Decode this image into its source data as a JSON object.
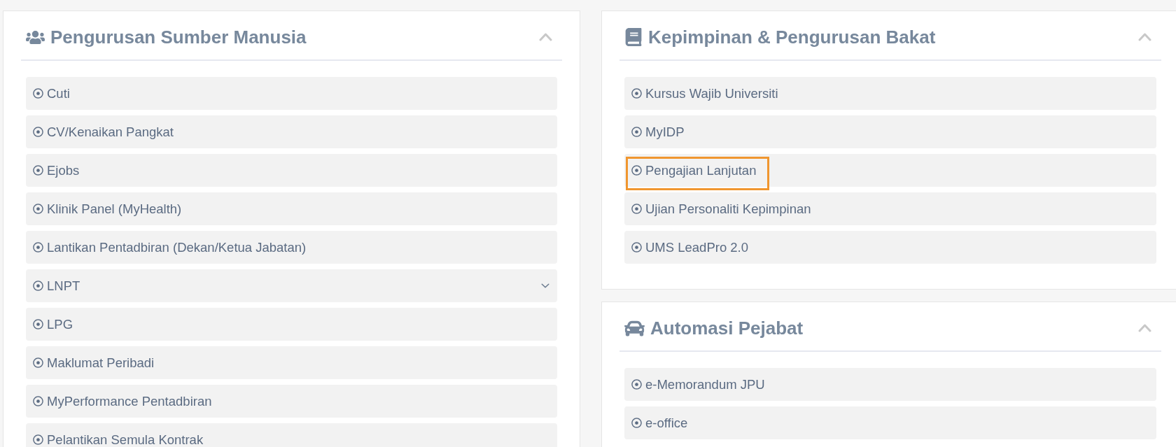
{
  "columns": [
    {
      "panels": [
        {
          "title": "Pengurusan Sumber Manusia",
          "expanded": true,
          "items": [
            {
              "label": "Cuti",
              "kind": "link",
              "highlighted": false
            },
            {
              "label": "CV/Kenaikan Pangkat",
              "kind": "link",
              "highlighted": false
            },
            {
              "label": "Ejobs",
              "kind": "link",
              "highlighted": false
            },
            {
              "label": "Klinik Panel (MyHealth)",
              "kind": "link",
              "highlighted": false
            },
            {
              "label": "Lantikan Pentadbiran (Dekan/Ketua Jabatan)",
              "kind": "link",
              "highlighted": false
            },
            {
              "label": "LNPT",
              "kind": "submenu",
              "expanded": false,
              "highlighted": false
            },
            {
              "label": "LPG",
              "kind": "link",
              "highlighted": false
            },
            {
              "label": "Maklumat Peribadi",
              "kind": "link",
              "highlighted": false
            },
            {
              "label": "MyPerformance Pentadbiran",
              "kind": "link",
              "highlighted": false
            },
            {
              "label": "Pelantikan Semula Kontrak",
              "kind": "link",
              "highlighted": false
            }
          ]
        }
      ]
    },
    {
      "panels": [
        {
          "title": "Kepimpinan & Pengurusan Bakat",
          "expanded": true,
          "items": [
            {
              "label": "Kursus Wajib Universiti",
              "kind": "link",
              "highlighted": false
            },
            {
              "label": "MyIDP",
              "kind": "link",
              "highlighted": false
            },
            {
              "label": "Pengajian Lanjutan",
              "kind": "link",
              "highlighted": true
            },
            {
              "label": "Ujian Personaliti Kepimpinan",
              "kind": "link",
              "highlighted": false
            },
            {
              "label": "UMS LeadPro 2.0",
              "kind": "link",
              "highlighted": false
            }
          ]
        },
        {
          "title": "Automasi Pejabat",
          "expanded": true,
          "items": [
            {
              "label": "e-Memorandum JPU",
              "kind": "link",
              "highlighted": false
            },
            {
              "label": "e-office",
              "kind": "link",
              "highlighted": false
            }
          ]
        }
      ]
    }
  ]
}
